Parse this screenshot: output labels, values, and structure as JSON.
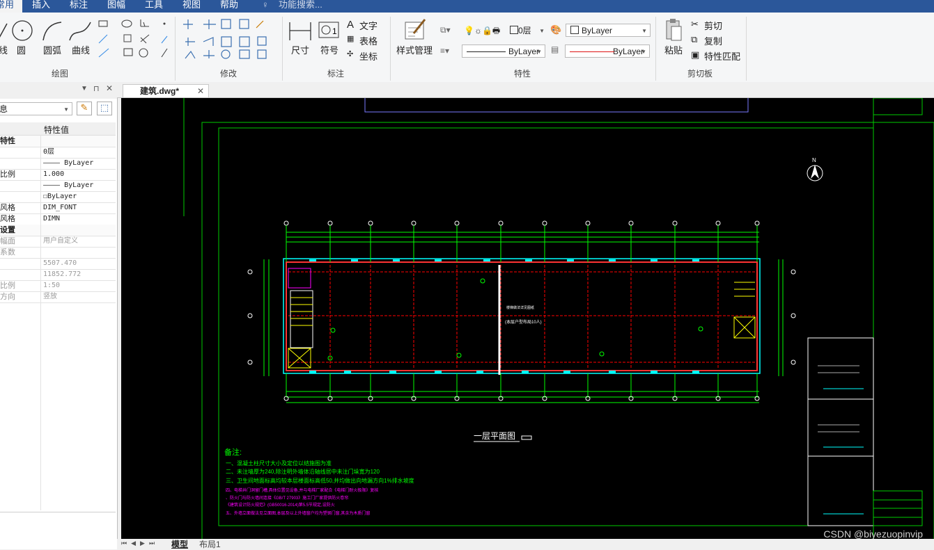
{
  "menu": {
    "tabs": [
      "常用",
      "插入",
      "标注",
      "图幅",
      "工具",
      "视图",
      "帮助"
    ],
    "search_placeholder": "功能搜索..."
  },
  "ribbon": {
    "draw": {
      "title": "绘图",
      "tools": [
        "线",
        "圆",
        "圆弧",
        "曲线"
      ]
    },
    "modify": {
      "title": "修改"
    },
    "annotate": {
      "title": "标注",
      "tools": [
        "尺寸",
        "符号"
      ],
      "text_label": "文字",
      "table_label": "表格",
      "coord_label": "坐标"
    },
    "style_manager_label": "样式管理",
    "properties": {
      "title": "特性",
      "layer_value": "0层",
      "color_value": "ByLayer",
      "linetype_value": "ByLayer",
      "lineweight_value": "ByLayer"
    },
    "clipboard": {
      "title": "剪切板",
      "paste_label": "粘贴",
      "cut_label": "剪切",
      "copy_label": "复制",
      "match_label": "特性匹配"
    }
  },
  "panel": {
    "header_label": "特性值",
    "selector_value": "息",
    "rows": [
      {
        "k": "特性",
        "v": "",
        "section": true
      },
      {
        "k": "",
        "v": "0层"
      },
      {
        "k": "",
        "v": "———— ByLayer"
      },
      {
        "k": "比例",
        "v": "1.000"
      },
      {
        "k": "",
        "v": "———— ByLayer"
      },
      {
        "k": "",
        "v": "☐ByLayer"
      },
      {
        "k": "风格",
        "v": "DIM_FONT"
      },
      {
        "k": "风格",
        "v": "DIMN"
      },
      {
        "k": "设置",
        "v": "",
        "section": true
      },
      {
        "k": "幅面",
        "v": "用户自定义",
        "grey": true
      },
      {
        "k": "系数",
        "v": "",
        "grey": true
      },
      {
        "k": "",
        "v": "5507.470",
        "grey": true
      },
      {
        "k": "",
        "v": "11852.772",
        "grey": true
      },
      {
        "k": "比例",
        "v": "1:50",
        "grey": true
      },
      {
        "k": "方向",
        "v": "竖放",
        "grey": true
      }
    ]
  },
  "document": {
    "tab_label": "建筑.dwg*"
  },
  "drawing": {
    "plan_title": "一层平面图",
    "notes_title": "备注:",
    "notes": [
      "一、混凝土柱尺寸大小及定位以结施图为准",
      "二、未注墙厚为240,除注明外墙体沿轴线居中未注门垛宽为120",
      "三、卫生间地面标高均较本层楼面标高低50,并均做出向地漏方向1%排水坡度",
      "四、电梯井门洞留门槽,具体位置见设备,并与电梯厂家配合《电梯门耐火极限》复核",
      "  、防火门与防火墙间连接《GB/T 27903》施工门厂家提供防火卷帘",
      "  《建筑设计防火规范》(GB50016-2014)第5.5节规定,设防火",
      "五、外墙立面做法见立面图,本层及以上外墙窗户均为塑钢门窗,其余为木质门窗"
    ],
    "stair_note": "楼梯做法详见图纸",
    "stair_note2": "(本层户型布局10人)",
    "north_label": "N"
  },
  "bottom": {
    "tab_model": "模型",
    "tab_layout": "布局1"
  },
  "watermark": "CSDN @biyezuopinvip",
  "colors": {
    "menubar": "#2b579a",
    "canvas": "#000000",
    "green": "#00ff00",
    "red": "#ff0000",
    "magenta": "#ff00ff",
    "cyan": "#00ffff"
  }
}
